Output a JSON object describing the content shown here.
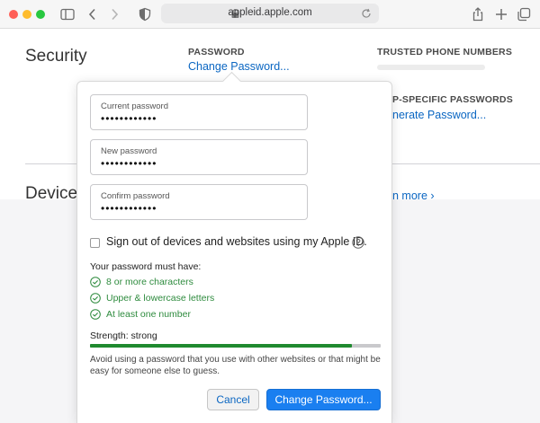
{
  "browser": {
    "url": "appleid.apple.com",
    "icons": {
      "sidebar": "sidebar-icon",
      "back": "chevron-left-icon",
      "forward": "chevron-right-icon",
      "privacy": "shield-icon",
      "lock": "lock-icon",
      "reload": "reload-icon",
      "share": "share-icon",
      "new_tab": "plus-icon",
      "tabs": "tabs-overview-icon"
    },
    "traffic_colors": [
      "#ff5f57",
      "#febc2e",
      "#28c840"
    ]
  },
  "page": {
    "security_title": "Security",
    "devices_title": "Device",
    "password_label": "PASSWORD",
    "change_password_link": "Change Password...",
    "trusted_label": "TRUSTED PHONE NUMBERS",
    "app_specific_label": "P-SPECIFIC PASSWORDS",
    "generate_link": "nerate Password...",
    "learn_more_link": "n more ›"
  },
  "popover": {
    "fields": [
      {
        "label": "Current password",
        "value": "••••••••••••"
      },
      {
        "label": "New password",
        "value": "••••••••••••"
      },
      {
        "label": "Confirm password",
        "value": "••••••••••••"
      }
    ],
    "signout_label": "Sign out of devices and websites using my Apple ID.",
    "signout_checked": false,
    "help_icon": "question-circle-icon",
    "requirements_title": "Your password must have:",
    "requirements": [
      {
        "text": "8 or more characters",
        "met": true
      },
      {
        "text": "Upper & lowercase letters",
        "met": true
      },
      {
        "text": "At least one number",
        "met": true
      }
    ],
    "strength_label": "Strength: strong",
    "strength_fraction": 0.9,
    "advice": "Avoid using a password that you use with other websites or that might be easy for someone else to guess.",
    "cancel_label": "Cancel",
    "change_label": "Change Password...",
    "colors": {
      "link": "#0a66c2",
      "primary": "#1a7ff0",
      "success": "#2e8b3e",
      "strength": "#1f8a2f"
    }
  }
}
